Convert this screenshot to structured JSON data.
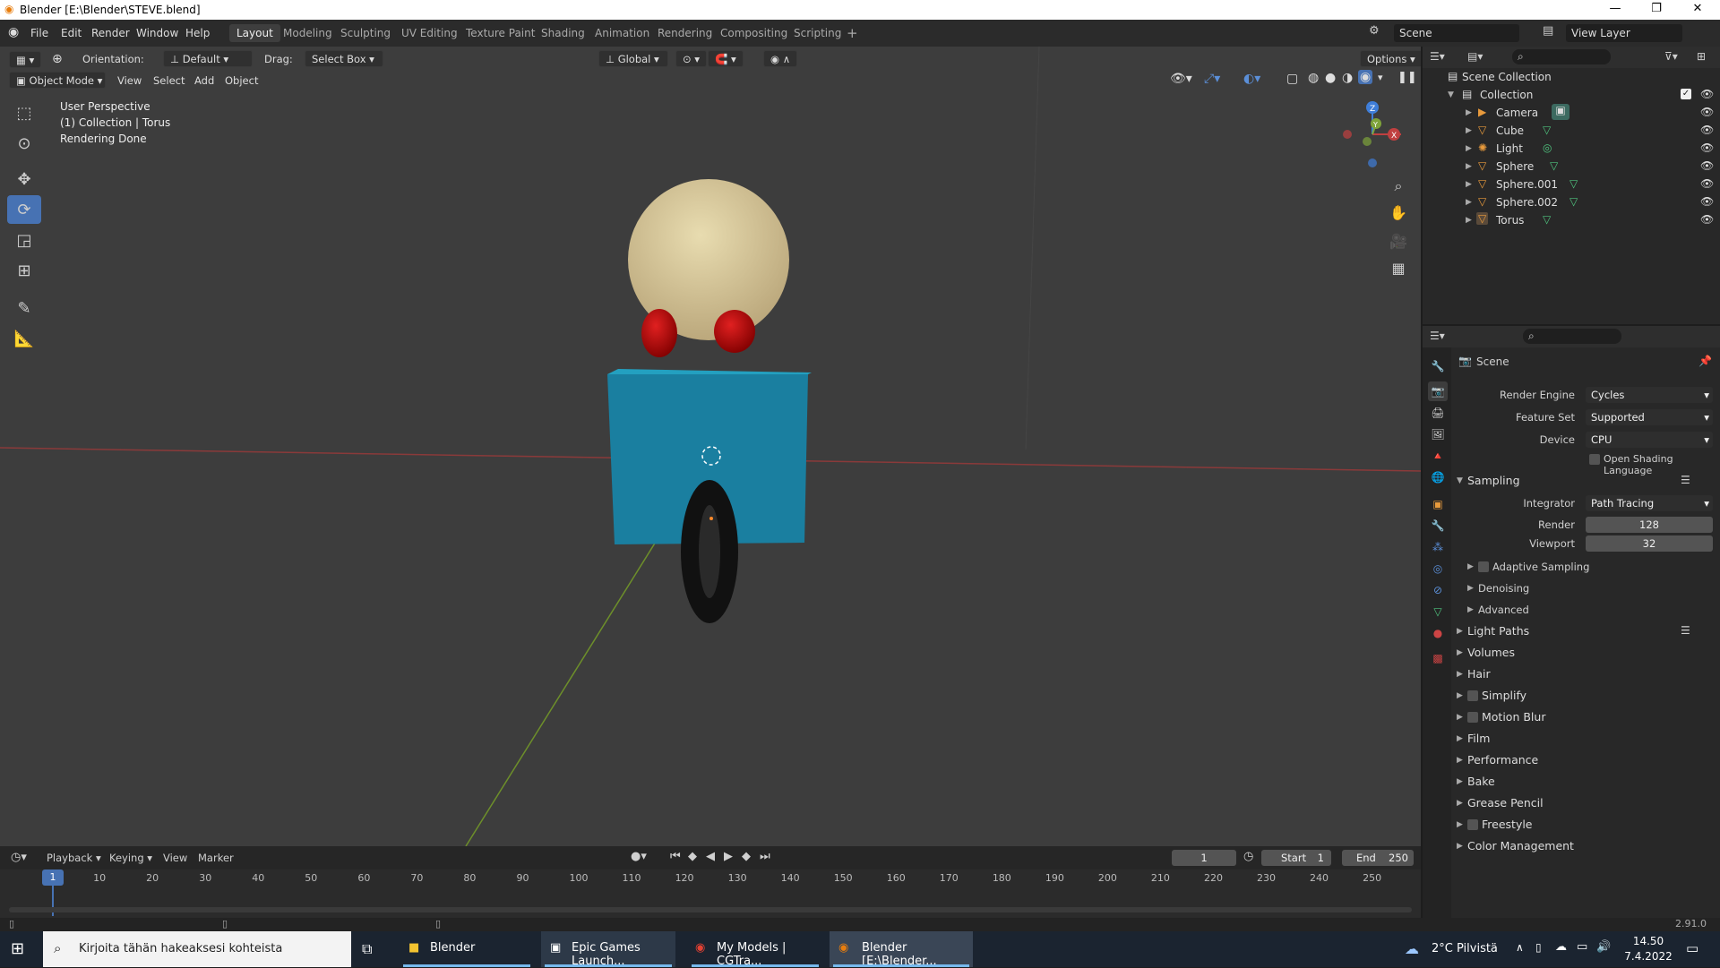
{
  "window": {
    "title": "Blender [E:\\Blender\\STEVE.blend]"
  },
  "menu": [
    "File",
    "Edit",
    "Render",
    "Window",
    "Help"
  ],
  "workspaces": [
    "Layout",
    "Modeling",
    "Sculpting",
    "UV Editing",
    "Texture Paint",
    "Shading",
    "Animation",
    "Rendering",
    "Compositing",
    "Scripting"
  ],
  "active_workspace": "Layout",
  "scene_selector": "Scene",
  "view_layer": "View Layer",
  "viewport_header": {
    "orientation_label": "Orientation:",
    "orientation_value": "Default",
    "drag_label": "Drag:",
    "drag_value": "Select Box",
    "transform_space": "Global",
    "options": "Options",
    "mode": "Object Mode",
    "menus": [
      "View",
      "Select",
      "Add",
      "Object"
    ]
  },
  "viewport_info": [
    "User Perspective",
    "(1) Collection | Torus",
    "Rendering Done"
  ],
  "gizmo_axes": {
    "x": "X",
    "y": "Y",
    "z": "Z"
  },
  "outliner": {
    "root": "Scene Collection",
    "collection": "Collection",
    "items": [
      "Camera",
      "Cube",
      "Light",
      "Sphere",
      "Sphere.001",
      "Sphere.002",
      "Torus"
    ]
  },
  "properties": {
    "header": "Scene",
    "render_engine_label": "Render Engine",
    "render_engine": "Cycles",
    "feature_set_label": "Feature Set",
    "feature_set": "Supported",
    "device_label": "Device",
    "device": "CPU",
    "osl_label": "Open Shading Language",
    "sampling": "Sampling",
    "integrator_label": "Integrator",
    "integrator": "Path Tracing",
    "render_label": "Render",
    "render_samples": "128",
    "viewport_label": "Viewport",
    "viewport_samples": "32",
    "sub_panels": [
      "Adaptive Sampling",
      "Denoising",
      "Advanced"
    ],
    "panels": [
      "Light Paths",
      "Volumes",
      "Hair",
      "Simplify",
      "Motion Blur",
      "Film",
      "Performance",
      "Bake",
      "Grease Pencil",
      "Freestyle",
      "Color Management"
    ]
  },
  "timeline": {
    "menus": [
      "Playback",
      "Keying",
      "View",
      "Marker"
    ],
    "current_frame": "1",
    "start_label": "Start",
    "start": "1",
    "end_label": "End",
    "end": "250",
    "ruler": [
      "10",
      "20",
      "30",
      "40",
      "50",
      "60",
      "70",
      "80",
      "90",
      "100",
      "110",
      "120",
      "130",
      "140",
      "150",
      "160",
      "170",
      "180",
      "190",
      "200",
      "210",
      "220",
      "230",
      "240",
      "250"
    ],
    "playhead": "1"
  },
  "status": {
    "version": "2.91.0"
  },
  "taskbar": {
    "search_placeholder": "Kirjoita tähän hakeaksesi kohteista",
    "apps": [
      "Blender",
      "Epic Games Launch...",
      "My Models | CGTra...",
      "Blender [E:\\Blender..."
    ],
    "weather": "2°C Pilvistä",
    "time": "14.50",
    "date": "7.4.2022"
  },
  "colors": {
    "accent": "#4772b3",
    "x_axis": "#c04040",
    "y_axis": "#7ea33a",
    "z_axis": "#3f7ed9"
  }
}
